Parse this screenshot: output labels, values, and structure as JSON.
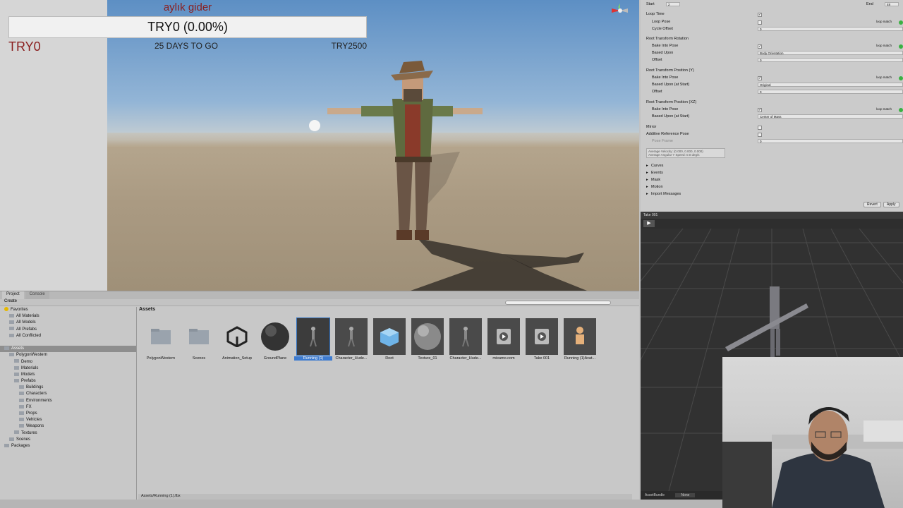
{
  "overlay": {
    "title": "aylık gider",
    "progress_text": "TRY0 (0.00%)",
    "progress_fraction": 0.0,
    "current_amount": "TRY0",
    "days_to_go": "25 DAYS TO GO",
    "target_amount": "TRY2500",
    "accent_color": "#8a1e1e"
  },
  "project_panel": {
    "tabs": [
      "Project",
      "Console"
    ],
    "create_label": "Create",
    "tree": [
      {
        "label": "Favorites",
        "icon": "star-icon",
        "indent": 0,
        "selected": false
      },
      {
        "label": "All Materials",
        "icon": "search-icon",
        "indent": 1,
        "selected": false
      },
      {
        "label": "All Models",
        "icon": "search-icon",
        "indent": 1,
        "selected": false
      },
      {
        "label": "All Prefabs",
        "icon": "search-icon",
        "indent": 1,
        "selected": false
      },
      {
        "label": "All Conflicted",
        "icon": "search-icon",
        "indent": 1,
        "selected": false
      },
      {
        "label": "",
        "icon": "",
        "indent": 0,
        "selected": false
      },
      {
        "label": "Assets",
        "icon": "folder-icon",
        "indent": 0,
        "selected": true
      },
      {
        "label": "PolygonWestern",
        "icon": "folder-icon",
        "indent": 1,
        "selected": false
      },
      {
        "label": "Demo",
        "icon": "folder-icon",
        "indent": 2,
        "selected": false
      },
      {
        "label": "Materials",
        "icon": "folder-icon",
        "indent": 2,
        "selected": false
      },
      {
        "label": "Models",
        "icon": "folder-icon",
        "indent": 2,
        "selected": false
      },
      {
        "label": "Prefabs",
        "icon": "folder-icon",
        "indent": 2,
        "selected": false
      },
      {
        "label": "Buildings",
        "icon": "folder-icon",
        "indent": 3,
        "selected": false
      },
      {
        "label": "Characters",
        "icon": "folder-icon",
        "indent": 3,
        "selected": false
      },
      {
        "label": "Environments",
        "icon": "folder-icon",
        "indent": 3,
        "selected": false
      },
      {
        "label": "FX",
        "icon": "folder-icon",
        "indent": 3,
        "selected": false
      },
      {
        "label": "Props",
        "icon": "folder-icon",
        "indent": 3,
        "selected": false
      },
      {
        "label": "Vehicles",
        "icon": "folder-icon",
        "indent": 3,
        "selected": false
      },
      {
        "label": "Weapons",
        "icon": "folder-icon",
        "indent": 3,
        "selected": false
      },
      {
        "label": "Textures",
        "icon": "folder-icon",
        "indent": 2,
        "selected": false
      },
      {
        "label": "Scenes",
        "icon": "folder-icon",
        "indent": 1,
        "selected": false
      },
      {
        "label": "Packages",
        "icon": "folder-icon",
        "indent": 0,
        "selected": false
      }
    ],
    "breadcrumb": "Assets",
    "assets": [
      {
        "label": "PolygonWestern",
        "icon": "folder-icon",
        "kind": "folder"
      },
      {
        "label": "Scenes",
        "icon": "folder-icon",
        "kind": "folder"
      },
      {
        "label": "Animation_Setup",
        "icon": "unity-logo-icon",
        "kind": "unity"
      },
      {
        "label": "GroundPlane",
        "icon": "sphere-icon",
        "kind": "sphere-dark"
      },
      {
        "label": "Running (1)",
        "icon": "character-icon",
        "kind": "selected"
      },
      {
        "label": "Character_Hude...",
        "icon": "character-icon",
        "kind": "dark"
      },
      {
        "label": "Root",
        "icon": "cube-icon",
        "kind": "cube"
      },
      {
        "label": "Texture_01",
        "icon": "sphere-icon",
        "kind": "sphere-grey"
      },
      {
        "label": "Character_Hude...",
        "icon": "character-icon",
        "kind": "dark-light"
      },
      {
        "label": "mixamo.com",
        "icon": "play-icon",
        "kind": "clip"
      },
      {
        "label": "Take 001",
        "icon": "play-icon",
        "kind": "clip"
      },
      {
        "label": "Running (1)Avat...",
        "icon": "avatar-icon",
        "kind": "avatar"
      }
    ],
    "status_path": "Assets/Running (1).fbx"
  },
  "inspector": {
    "start_label": "Start",
    "start_value": "2",
    "end_label": "End",
    "end_value": "48",
    "rows": [
      {
        "label": "Loop Time",
        "type": "check",
        "checked": true,
        "indent": 0
      },
      {
        "label": "Loop Pose",
        "type": "check",
        "checked": false,
        "indent": 1,
        "loop_match": "loop match"
      },
      {
        "label": "Cycle Offset",
        "type": "field",
        "value": "0",
        "indent": 1
      },
      {
        "label": "Root Transform Rotation",
        "type": "header",
        "indent": 0
      },
      {
        "label": "Bake Into Pose",
        "type": "check",
        "checked": true,
        "indent": 1,
        "loop_match": "loop match"
      },
      {
        "label": "Based Upon",
        "type": "field",
        "value": "Body Orientation",
        "indent": 1
      },
      {
        "label": "Offset",
        "type": "field",
        "value": "0",
        "indent": 1
      },
      {
        "label": "Root Transform Position (Y)",
        "type": "header",
        "indent": 0
      },
      {
        "label": "Bake Into Pose",
        "type": "check",
        "checked": true,
        "indent": 1,
        "loop_match": "loop match"
      },
      {
        "label": "Based Upon (at Start)",
        "type": "field",
        "value": "Original",
        "indent": 1
      },
      {
        "label": "Offset",
        "type": "field",
        "value": "0",
        "indent": 1
      },
      {
        "label": "Root Transform Position (XZ)",
        "type": "header",
        "indent": 0
      },
      {
        "label": "Bake Into Pose",
        "type": "check",
        "checked": true,
        "indent": 1,
        "loop_match": "loop match"
      },
      {
        "label": "Based Upon (at Start)",
        "type": "field",
        "value": "Center of Mass",
        "indent": 1
      },
      {
        "label": "Mirror",
        "type": "check",
        "checked": false,
        "indent": 0
      },
      {
        "label": "Additive Reference Pose",
        "type": "check",
        "checked": false,
        "indent": 0
      },
      {
        "label": "Pose Frame",
        "type": "field",
        "value": "0",
        "indent": 1
      }
    ],
    "average_velocity": "Average Velocity: (0.000, 0.000, 0.000)",
    "average_angular": "Average Angular Y Speed: 0.0 deg/s",
    "foldouts": [
      "Curves",
      "Events",
      "Mask",
      "Motion",
      "Import Messages"
    ],
    "revert_label": "Revert",
    "apply_label": "Apply",
    "take_label": "Take 001",
    "asset_bundle_label": "AssetBundle",
    "asset_bundle_value": "None"
  }
}
